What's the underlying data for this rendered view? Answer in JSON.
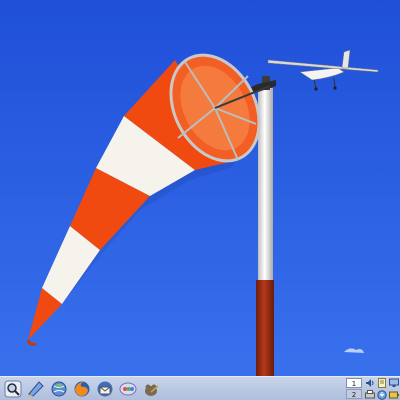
{
  "desktop": {
    "wallpaper": {
      "sky_color": "#2c5fe0",
      "windsock_colors": [
        "#f04a10",
        "#f6f2ec"
      ],
      "pole_colors": [
        "#f2f2f2",
        "#9a2a12"
      ]
    }
  },
  "taskbar": {
    "launchers": [
      {
        "icon": "magnifier-icon"
      },
      {
        "icon": "file-manager-icon"
      },
      {
        "icon": "globe-icon"
      },
      {
        "icon": "firefox-icon"
      },
      {
        "icon": "thunderbird-icon"
      },
      {
        "icon": "pidgin-icon"
      },
      {
        "icon": "gimp-icon"
      }
    ],
    "workspaces": [
      {
        "label": "1",
        "active": true
      },
      {
        "label": "2",
        "active": false
      }
    ],
    "tray": [
      {
        "icon": "volume-icon"
      },
      {
        "icon": "notes-icon"
      },
      {
        "icon": "network-icon"
      },
      {
        "icon": "printer-icon"
      },
      {
        "icon": "update-icon"
      },
      {
        "icon": "battery-icon"
      }
    ]
  }
}
